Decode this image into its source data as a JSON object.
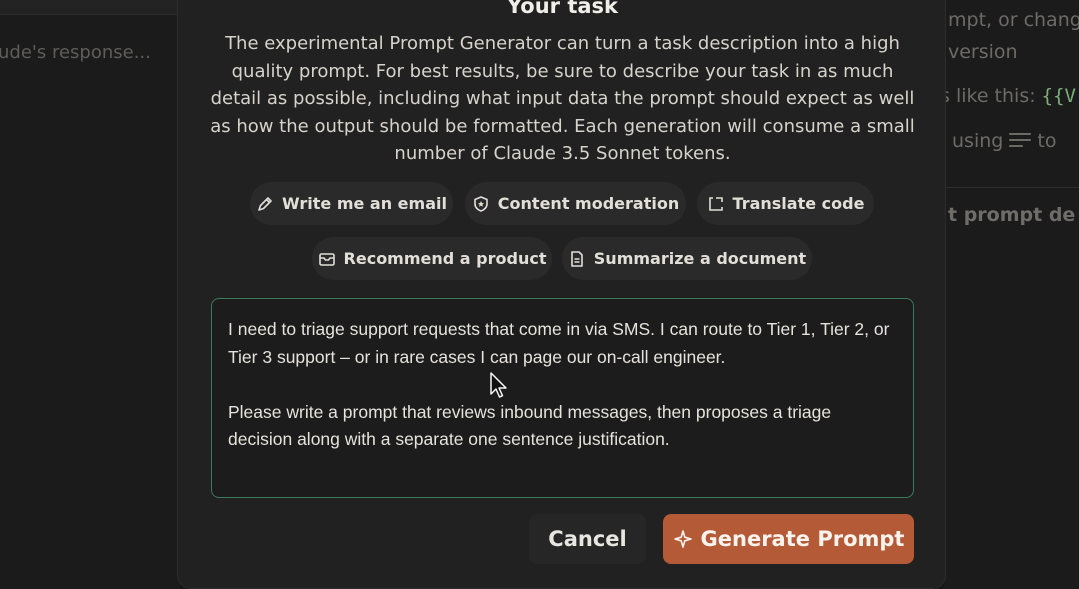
{
  "background": {
    "left_text": "ude's response...",
    "right_lines": {
      "line1": "mpt, or chang",
      "line2": "version",
      "line3_prefix": "s like this: ",
      "line3_var": "{{V",
      "line4_prefix": "using ",
      "line4_suffix": " to",
      "heading": "t prompt de"
    }
  },
  "modal": {
    "title": "Your task",
    "description": "The experimental Prompt Generator can turn a task description into a high quality prompt. For best results, be sure to describe your task in as much detail as possible, including what input data the prompt should expect as well as how the output should be formatted. Each generation will consume a small number of Claude 3.5 Sonnet tokens.",
    "examples": [
      {
        "label": "Write me an email",
        "icon": "pen-icon"
      },
      {
        "label": "Content moderation",
        "icon": "shield-icon"
      },
      {
        "label": "Translate code",
        "icon": "code-bracket-icon"
      },
      {
        "label": "Recommend a product",
        "icon": "envelope-icon"
      },
      {
        "label": "Summarize a document",
        "icon": "document-icon"
      }
    ],
    "task_text": {
      "paragraph1": "I need to triage support requests that come in via SMS. I can route to Tier 1, Tier 2, or Tier 3 support – or in rare cases I can page our on-call engineer.",
      "paragraph2": "Please write a prompt that reviews inbound messages, then proposes a triage decision along with a separate one sentence justification."
    },
    "cancel_label": "Cancel",
    "generate_label": "Generate Prompt"
  },
  "colors": {
    "accent": "#b45a37",
    "focus_border": "#3d7a5c",
    "variable_text": "#7cae7a"
  }
}
